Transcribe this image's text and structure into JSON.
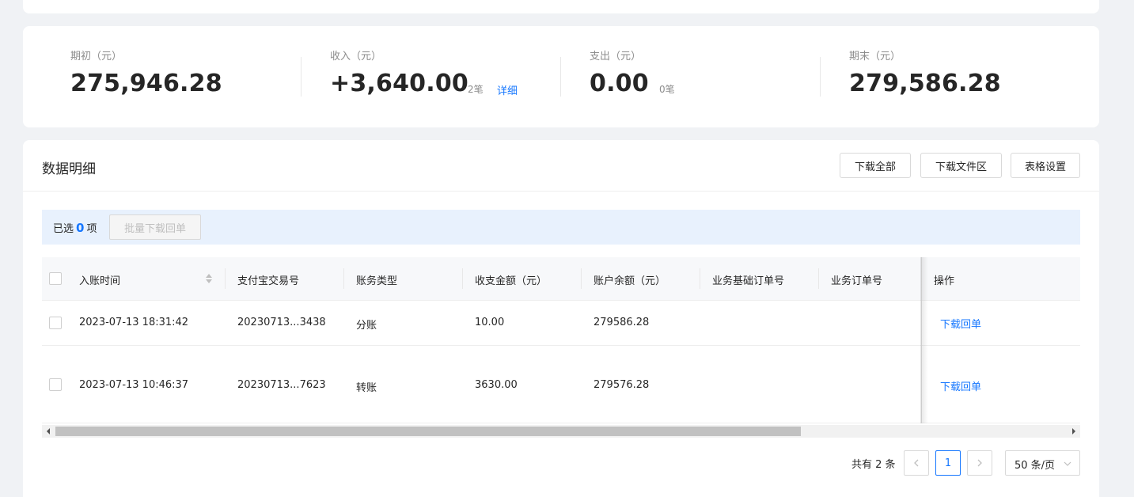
{
  "summary": {
    "opening": {
      "label": "期初（元）",
      "value": "275,946.28"
    },
    "income": {
      "label": "收入（元）",
      "value": "+3,640.00",
      "count": "2笔",
      "detail_link": "详细"
    },
    "expense": {
      "label": "支出（元）",
      "value": "0.00",
      "count": "0笔"
    },
    "closing": {
      "label": "期末（元）",
      "value": "279,586.28"
    }
  },
  "detail": {
    "title": "数据明细",
    "buttons": {
      "download_all": "下载全部",
      "download_files": "下载文件区",
      "table_settings": "表格设置"
    },
    "selection": {
      "prefix": "已选",
      "count": "0",
      "suffix": "项",
      "batch_download": "批量下载回单"
    },
    "columns": [
      "入账时间",
      "支付宝交易号",
      "账务类型",
      "收支金额（元）",
      "账户余额（元）",
      "业务基础订单号",
      "业务订单号",
      "操作"
    ],
    "rows": [
      {
        "time": "2023-07-13 18:31:42",
        "trade_no": "20230713...3438",
        "type": "分账",
        "amount": "10.00",
        "balance": "279586.28",
        "base_order": "",
        "order": "",
        "action": "下载回单"
      },
      {
        "time": "2023-07-13 10:46:37",
        "trade_no": "20230713...7623",
        "type": "转账",
        "amount": "3630.00",
        "balance": "279576.28",
        "base_order": "",
        "order": "",
        "action": "下载回单"
      }
    ]
  },
  "pagination": {
    "total": "共有 2 条",
    "current_page": "1",
    "page_size": "50 条/页"
  },
  "colors": {
    "accent": "#1677ff",
    "selection_bar": "#e8f1fd",
    "background": "#f0f2f5"
  }
}
